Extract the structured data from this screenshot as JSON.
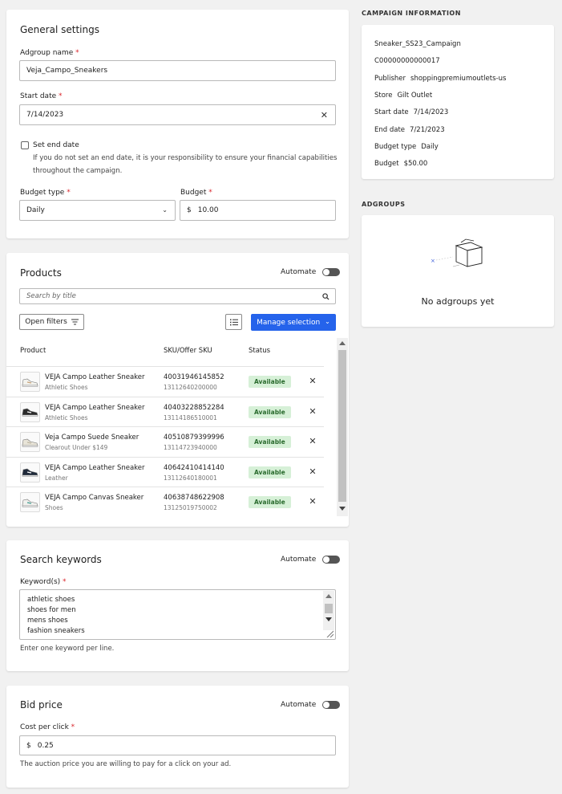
{
  "general": {
    "title": "General settings",
    "adgroup_label": "Adgroup name",
    "adgroup_value": "Veja_Campo_Sneakers",
    "start_label": "Start date",
    "start_value": "7/14/2023",
    "end_checkbox_label": "Set end date",
    "end_hint_1": "If you do not set an end date, it is your responsibility to ensure your financial capabilities",
    "end_hint_2": "throughout the campaign.",
    "budget_type_label": "Budget type",
    "budget_type_value": "Daily",
    "budget_label": "Budget",
    "budget_currency": "$",
    "budget_value": "10.00",
    "required_mark": "*"
  },
  "products": {
    "title": "Products",
    "automate_label": "Automate",
    "search_placeholder": "Search by title",
    "open_filters_label": "Open filters",
    "manage_selection_label": "Manage selection",
    "columns": [
      "Product",
      "SKU/Offer SKU",
      "Status"
    ],
    "items": [
      {
        "name": "VEJA Campo Leather Sneaker",
        "category": "Athletic Shoes",
        "sku": "40031946145852",
        "offer_sku": "13112640200000",
        "status": "Available",
        "shoe_color": "#f3f3ee",
        "accent": "#c9a37a"
      },
      {
        "name": "VEJA Campo Leather Sneaker",
        "category": "Athletic Shoes",
        "sku": "40403228852284",
        "offer_sku": "13114186510001",
        "status": "Available",
        "shoe_color": "#2b2b2b",
        "accent": "#ffffff"
      },
      {
        "name": "Veja Campo Suede Sneaker",
        "category": "Clearout Under $149",
        "sku": "40510879399996",
        "offer_sku": "13114723940000",
        "status": "Available",
        "shoe_color": "#e8e4d8",
        "accent": "#bdb6a2"
      },
      {
        "name": "VEJA Campo Leather Sneaker",
        "category": "Leather",
        "sku": "40642410414140",
        "offer_sku": "13112640180001",
        "status": "Available",
        "shoe_color": "#1f2a3a",
        "accent": "#ffffff"
      },
      {
        "name": "VEJA Campo Canvas Sneaker",
        "category": "Shoes",
        "sku": "40638748622908",
        "offer_sku": "13125019750002",
        "status": "Available",
        "shoe_color": "#f1f1ee",
        "accent": "#3f9b8f"
      }
    ]
  },
  "keywords": {
    "title": "Search keywords",
    "automate_label": "Automate",
    "label": "Keyword(s)",
    "lines": [
      "athletic shoes",
      "shoes for men",
      "mens shoes",
      "fashion sneakers"
    ],
    "hint": "Enter one keyword per line."
  },
  "bid": {
    "title": "Bid price",
    "automate_label": "Automate",
    "label": "Cost per click",
    "currency": "$",
    "value": "0.25",
    "hint": "The auction price you are willing to pay for a click on your ad."
  },
  "campaign_info": {
    "heading": "CAMPAIGN INFORMATION",
    "name": "Sneaker_SS23_Campaign",
    "id": "C00000000000017",
    "publisher_label": "Publisher",
    "publisher_value": "shoppingpremiumoutlets-us",
    "store_label": "Store",
    "store_value": "Gilt Outlet",
    "start_label": "Start date",
    "start_value": "7/14/2023",
    "end_label": "End date",
    "end_value": "7/21/2023",
    "budget_type_label": "Budget type",
    "budget_type_value": "Daily",
    "budget_label": "Budget",
    "budget_value": "$50.00"
  },
  "adgroups": {
    "heading": "ADGROUPS",
    "empty_text": "No adgroups yet"
  },
  "colors": {
    "primary": "#2563eb",
    "required": "#d9262c",
    "badge_bg": "#d6f0d7",
    "badge_text": "#2a6b2e"
  }
}
